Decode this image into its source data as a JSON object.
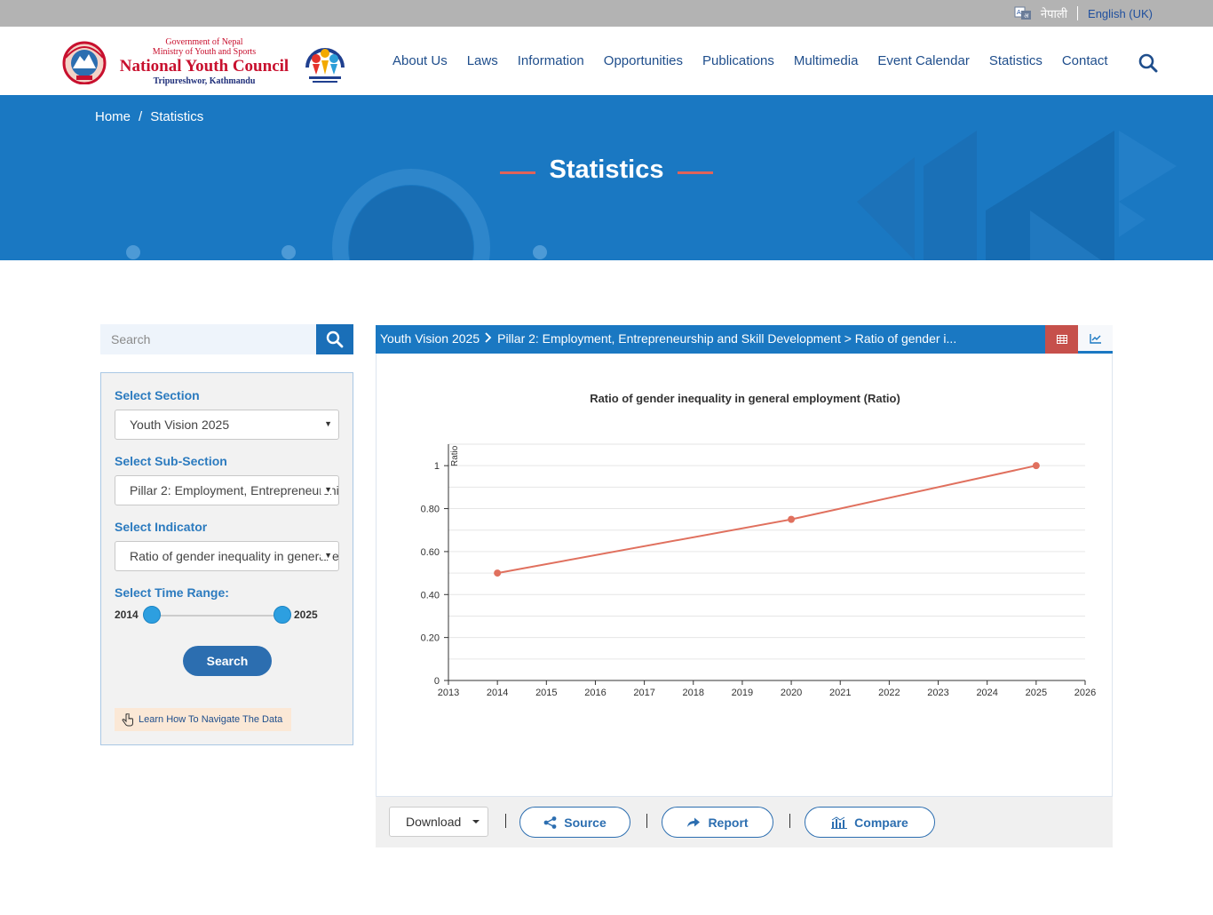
{
  "topbar": {
    "nepali": "नेपाली",
    "english": "English (UK)"
  },
  "logo": {
    "line1": "Government of Nepal",
    "line2": "Ministry of Youth and Sports",
    "line3": "National Youth Council",
    "line4": "Tripureshwor, Kathmandu"
  },
  "nav": {
    "items": [
      "About Us",
      "Laws",
      "Information",
      "Opportunities",
      "Publications",
      "Multimedia",
      "Event Calendar",
      "Statistics",
      "Contact"
    ]
  },
  "banner": {
    "breadcrumb_home": "Home",
    "breadcrumb_sep": "/",
    "breadcrumb_current": "Statistics",
    "title": "Statistics"
  },
  "sidebar": {
    "search_placeholder": "Search",
    "section_label": "Select Section",
    "section_value": "Youth Vision 2025",
    "subsection_label": "Select Sub-Section",
    "subsection_value": "Pillar 2: Employment, Entrepreneurship and Skill Development",
    "indicator_label": "Select Indicator",
    "indicator_value": "Ratio of gender inequality in general employment",
    "time_label": "Select Time Range:",
    "range_min": "2014",
    "range_max": "2025",
    "search_button": "Search",
    "learn_link": "Learn How To Navigate The Data"
  },
  "main": {
    "path_section": "Youth Vision 2025",
    "path_rest": "Pillar 2: Employment, Entrepreneurship and Skill Development > Ratio of gender i...",
    "download": "Download",
    "source": "Source",
    "report": "Report",
    "compare": "Compare"
  },
  "colors": {
    "primary": "#1a78c2",
    "accent": "#c6504b",
    "line": "#e0705e"
  },
  "chart_data": {
    "type": "line",
    "title": "Ratio of gender inequality in general employment (Ratio)",
    "ylabel": "Ratio",
    "xlabel": "",
    "x_ticks": [
      "2013",
      "2014",
      "2015",
      "2016",
      "2017",
      "2018",
      "2019",
      "2020",
      "2021",
      "2022",
      "2023",
      "2024",
      "2025",
      "2026"
    ],
    "y_ticks": [
      "0",
      "0.20",
      "0.40",
      "0.60",
      "0.80",
      "1"
    ],
    "xlim": [
      2013,
      2026
    ],
    "ylim": [
      0,
      1.1
    ],
    "grid": true,
    "legend": "none",
    "series": [
      {
        "x": [
          2014,
          2020,
          2025
        ],
        "y": [
          0.5,
          0.75,
          1.0
        ]
      }
    ]
  }
}
